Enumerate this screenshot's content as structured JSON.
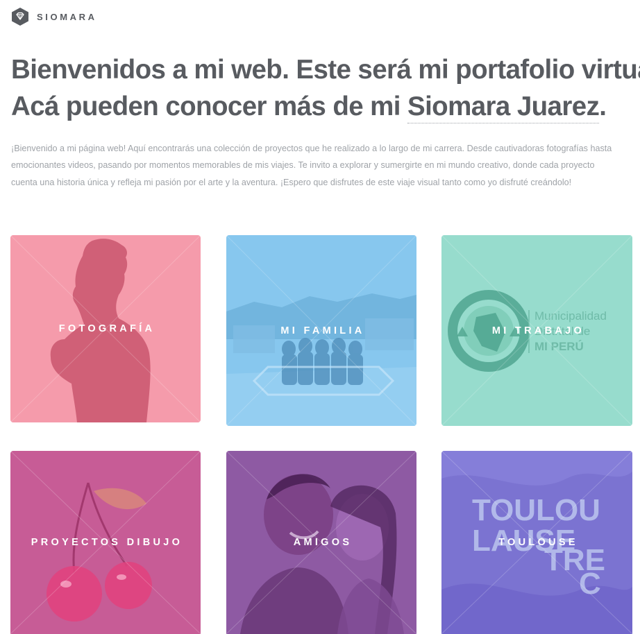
{
  "site": {
    "brand": "SIOMARA",
    "logo_icon": "diamond-hex-icon"
  },
  "hero": {
    "line1": "Bienvenidos a mi web. Este será mi portafolio virtual",
    "line2_prefix": "Acá pueden conocer más de mi ",
    "line2_name": "Siomara Juarez",
    "line2_suffix": "."
  },
  "intro": "¡Bienvenido a mi página web! Aquí encontrarás una colección de proyectos que he realizado a lo largo de mi carrera. Desde cautivadoras fotografías hasta emocionantes videos, pasando por momentos memorables de mis viajes. Te invito a explorar y sumergirte en mi mundo creativo, donde cada proyecto cuenta una historia única y refleja mi pasión por el arte y la aventura. ¡Espero que disfrutes de este viaje visual tanto como yo disfruté creándolo!",
  "tiles": [
    {
      "label": "FOTOGRAFÍA",
      "color": "#f59bab"
    },
    {
      "label": "MI FAMILIA",
      "color": "#87c7ee"
    },
    {
      "label": "MI TRABAJO",
      "color": "#97dccd",
      "logo_texts": [
        "Municipalidad",
        "Distrital de",
        "MI PERÚ"
      ]
    },
    {
      "label": "PROYECTOS DIBUJO",
      "color": "#c75c96"
    },
    {
      "label": "AMIGOS",
      "color": "#8e5aa3"
    },
    {
      "label": "TOULOUSE",
      "color": "#7b73d1",
      "poster_lines": [
        "TOULOU",
        "LAUSE",
        "TRE",
        "C"
      ]
    }
  ]
}
